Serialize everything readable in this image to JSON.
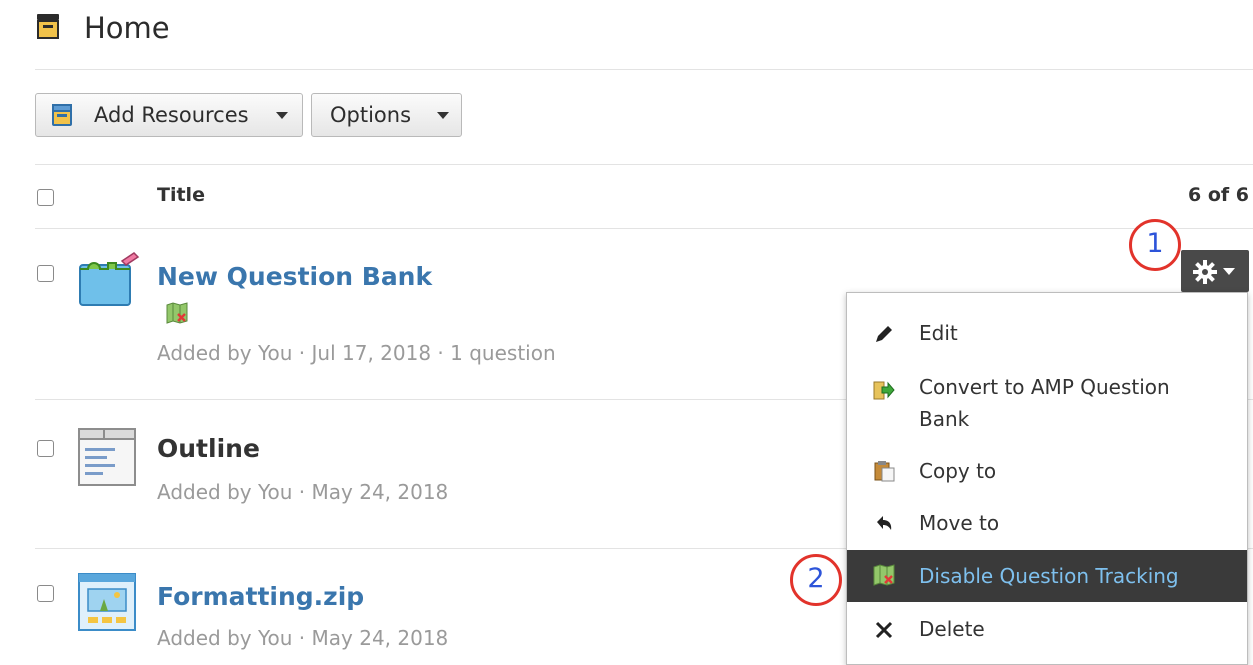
{
  "header": {
    "title": "Home"
  },
  "toolbar": {
    "add_resources_label": "Add Resources",
    "options_label": "Options"
  },
  "list": {
    "column_title": "Title",
    "count": "6 of 6",
    "items": [
      {
        "title": "New Question Bank",
        "meta": "Added by You · Jul 17, 2018 · 1 question"
      },
      {
        "title": "Outline",
        "meta": "Added by You · May 24, 2018"
      },
      {
        "title": "Formatting.zip",
        "meta": "Added by You · May 24, 2018"
      }
    ]
  },
  "menu": {
    "items": [
      {
        "label": "Edit",
        "icon": "pencil-icon"
      },
      {
        "label_line1": "Convert to AMP Question",
        "label_line2": "Bank",
        "icon": "convert-icon"
      },
      {
        "label": "Copy to",
        "icon": "clipboard-icon"
      },
      {
        "label": "Move to",
        "icon": "undo-arrow-icon"
      },
      {
        "label": "Disable Question Tracking",
        "icon": "map-icon"
      },
      {
        "label": "Delete",
        "icon": "x-icon"
      }
    ]
  },
  "callouts": {
    "one": "1",
    "two": "2"
  },
  "colors": {
    "link": "#3a76ad",
    "active_menu_bg": "#3a3a3a",
    "active_menu_text": "#7ec0ee",
    "callout_ring": "#e2332b"
  }
}
